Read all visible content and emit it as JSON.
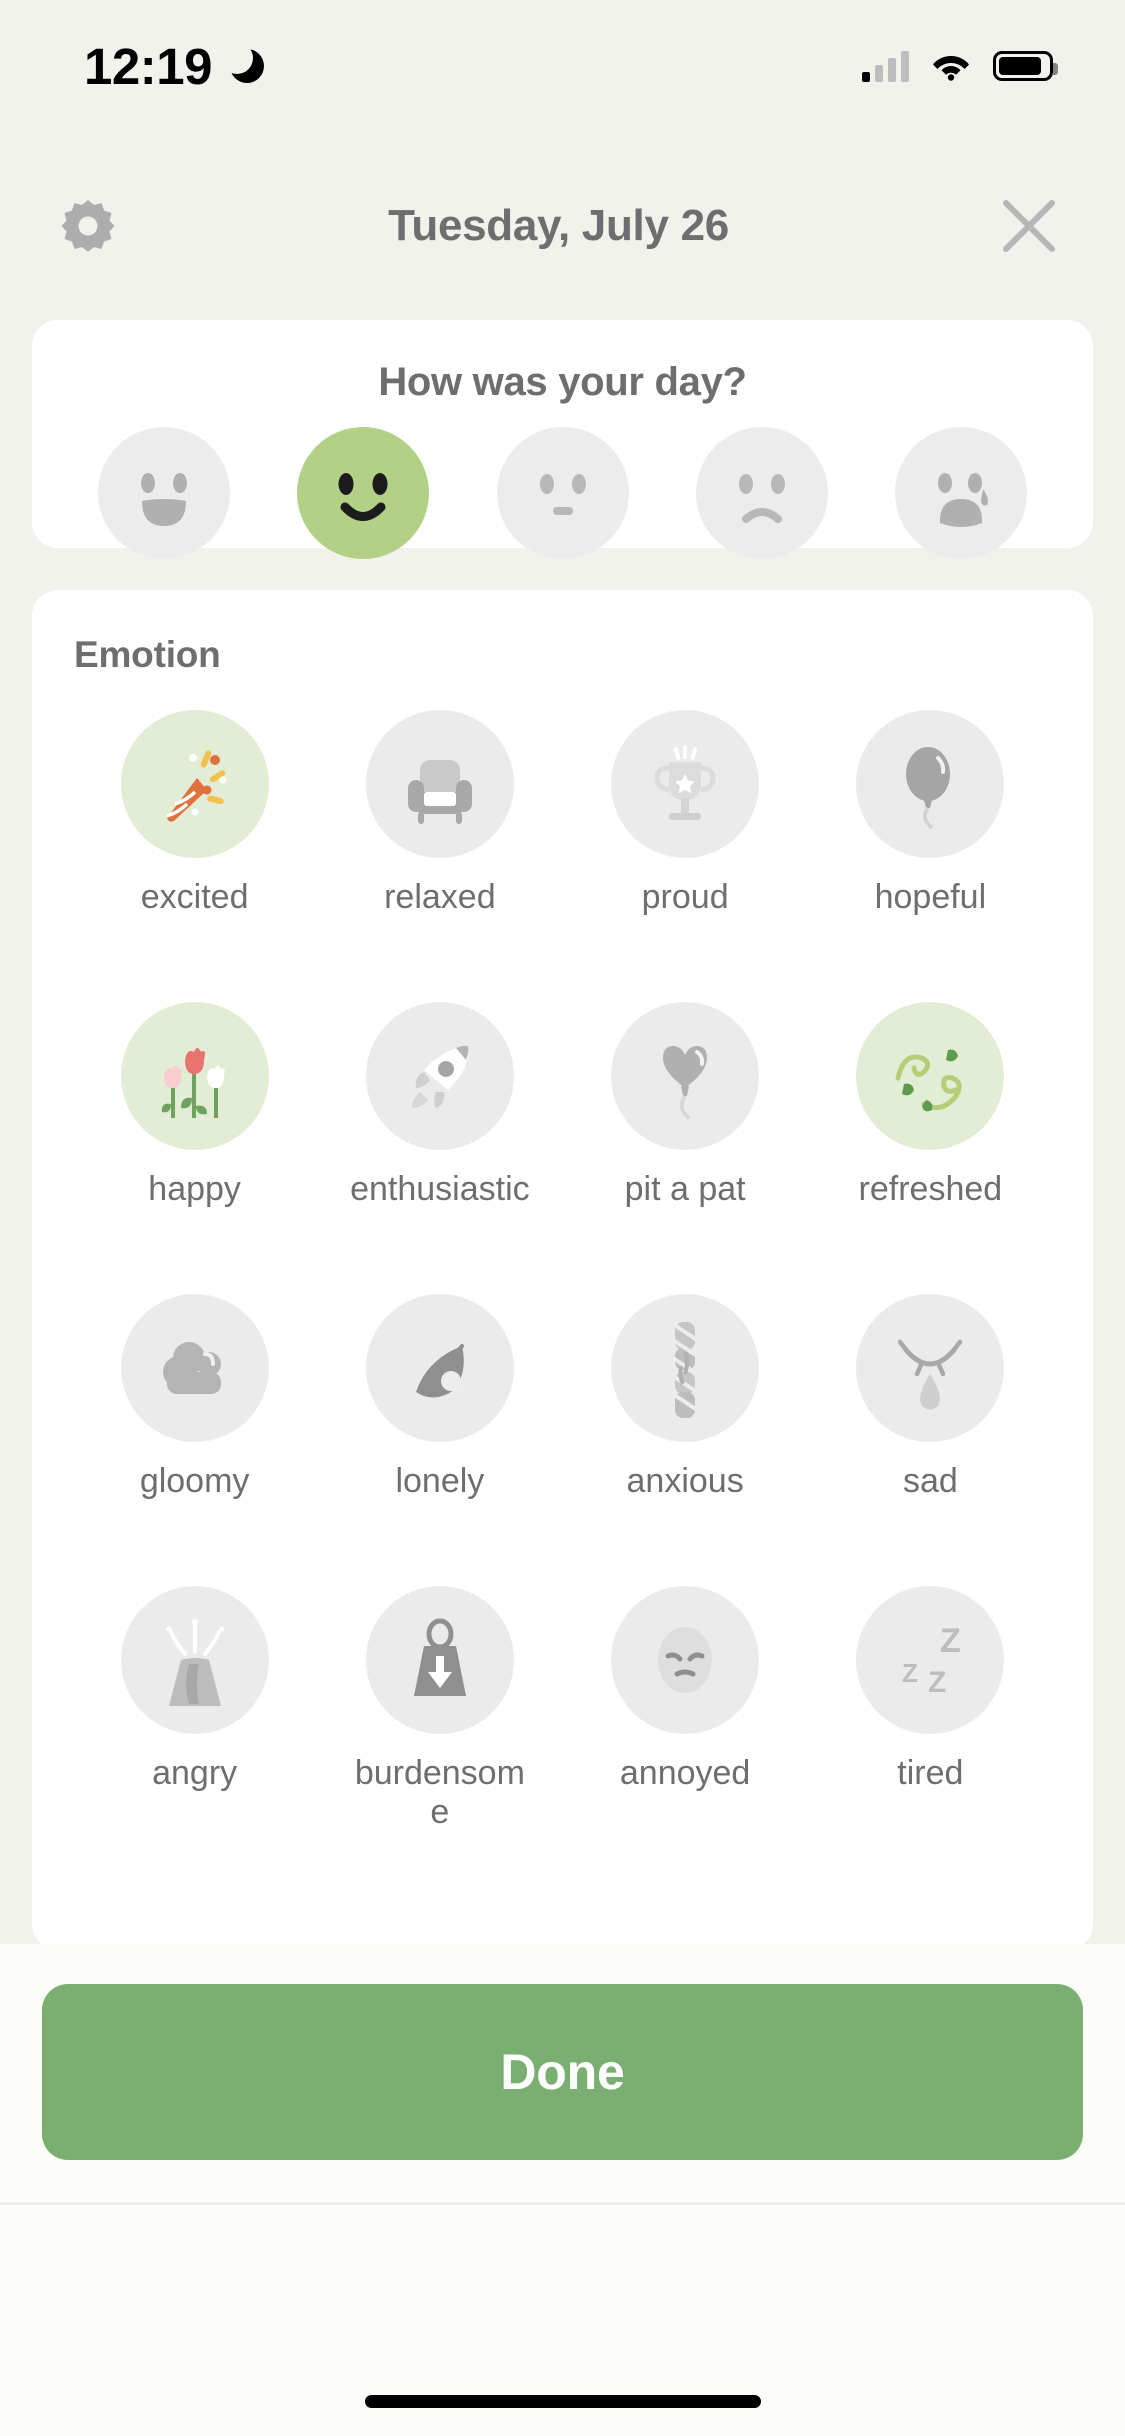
{
  "statusbar": {
    "time": "12:19",
    "dnd_icon": "crescent-moon-icon",
    "signal_icon": "cellular-signal-icon",
    "wifi_icon": "wifi-icon",
    "battery_icon": "battery-icon"
  },
  "header": {
    "settings_icon": "gear-icon",
    "title": "Tuesday, July 26",
    "close_icon": "close-icon"
  },
  "mood": {
    "question": "How was your day?",
    "selected_index": 1,
    "selected_color": "#b2d186",
    "unselected_color": "#ececec",
    "options": [
      {
        "name": "very-happy-face",
        "state": "unselected"
      },
      {
        "name": "happy-face",
        "state": "selected"
      },
      {
        "name": "neutral-face",
        "state": "unselected"
      },
      {
        "name": "sad-face",
        "state": "unselected"
      },
      {
        "name": "very-sad-face",
        "state": "unselected"
      }
    ]
  },
  "emotion": {
    "title": "Emotion",
    "selected_bg": "#e3ecd5",
    "unselected_bg": "#ebebeb",
    "items": [
      {
        "label": "excited",
        "icon": "party-popper-icon",
        "selected": true
      },
      {
        "label": "relaxed",
        "icon": "armchair-icon",
        "selected": false
      },
      {
        "label": "proud",
        "icon": "trophy-icon",
        "selected": false
      },
      {
        "label": "hopeful",
        "icon": "balloon-icon",
        "selected": false
      },
      {
        "label": "happy",
        "icon": "tulips-icon",
        "selected": true
      },
      {
        "label": "enthusiastic",
        "icon": "rocket-icon",
        "selected": false
      },
      {
        "label": "pit a pat",
        "icon": "heart-balloon-icon",
        "selected": false
      },
      {
        "label": "refreshed",
        "icon": "leaf-swirl-icon",
        "selected": true
      },
      {
        "label": "gloomy",
        "icon": "cloud-icon",
        "selected": false
      },
      {
        "label": "lonely",
        "icon": "falling-leaf-icon",
        "selected": false
      },
      {
        "label": "anxious",
        "icon": "twisted-rope-icon",
        "selected": false
      },
      {
        "label": "sad",
        "icon": "crying-eye-icon",
        "selected": false
      },
      {
        "label": "angry",
        "icon": "volcano-icon",
        "selected": false
      },
      {
        "label": "burdensome",
        "icon": "weight-icon",
        "selected": false
      },
      {
        "label": "annoyed",
        "icon": "annoyed-face-icon",
        "selected": false
      },
      {
        "label": "tired",
        "icon": "sleeping-zzz-icon",
        "selected": false
      }
    ]
  },
  "footer": {
    "done_label": "Done",
    "done_color": "#7aaf71"
  }
}
